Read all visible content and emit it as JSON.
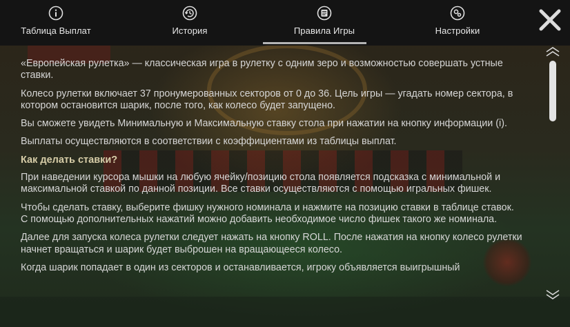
{
  "tabs": [
    {
      "label": "Таблица Выплат",
      "icon": "info-icon"
    },
    {
      "label": "История",
      "icon": "history-icon"
    },
    {
      "label": "Правила Игры",
      "icon": "rules-icon",
      "active": true
    },
    {
      "label": "Настройки",
      "icon": "settings-icon"
    }
  ],
  "close_icon": "close-icon",
  "content": {
    "p1": "«Европейская рулетка» — классическая игра в рулетку с одним зеро и возможностью совершать устные ставки.",
    "p2": "Колесо рулетки включает 37 пронумерованных секторов от 0 до 36. Цель игры — угадать номер сектора, в котором остановится шарик, после того, как колесо будет запущено.",
    "p3": "Вы сможете увидеть Минимальную и Максимальную ставку стола при нажатии на кнопку информации (i).",
    "p4": "Выплаты осуществляются в соответствии с коэффициентами из таблицы выплат.",
    "h1": "Как делать ставки?",
    "p5": "При наведении курсора мышки на любую ячейку/позицию стола появляется подсказка с минимальной и максимальной ставкой по данной позиции. Все ставки осуществляются с помощью игральных фишек.",
    "p6": "Чтобы сделать ставку, выберите фишку нужного номинала и нажмите на позицию ставки в таблице ставок. С помощью дополнительных нажатий можно добавить необходимое число фишек такого же номинала.",
    "p7": "Далее для запуска колеса рулетки следует нажать на кнопку ROLL. После нажатия на кнопку колесо рулетки начнет вращаться и шарик будет выброшен на вращающееся колесо.",
    "p8": "Когда шарик попадает в один из секторов и останавливается, игроку объявляется выигрышный"
  },
  "colors": {
    "text": "#d6d6d6",
    "heading": "#d7cda8",
    "topbar": "#141414",
    "active_underline": "#b5b5b5"
  }
}
